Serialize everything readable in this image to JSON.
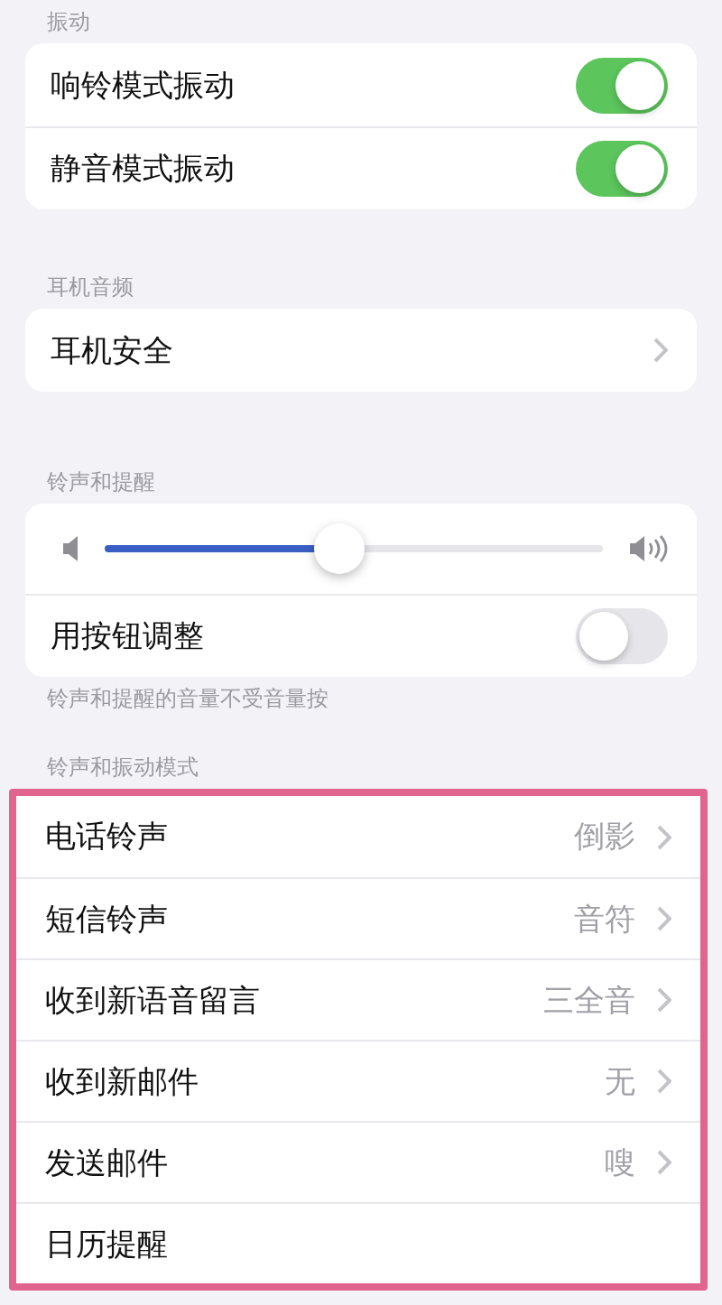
{
  "sections": [
    {
      "header": "振动",
      "highlighted": false,
      "rows": [
        {
          "kind": "toggle",
          "label": "响铃模式振动",
          "on": true
        },
        {
          "kind": "toggle",
          "label": "静音模式振动",
          "on": true
        }
      ]
    },
    {
      "header": "耳机音频",
      "highlighted": false,
      "rows": [
        {
          "kind": "link",
          "label": "耳机安全"
        }
      ]
    },
    {
      "header": "铃声和提醒",
      "highlighted": false,
      "rows": [
        {
          "kind": "slider",
          "level": 0.47
        },
        {
          "kind": "toggle",
          "label": "用按钮调整",
          "on": false
        }
      ],
      "footer": "铃声和提醒的音量不受音量按"
    },
    {
      "header": "铃声和振动模式",
      "highlighted": true,
      "rows": [
        {
          "kind": "link",
          "label": "电话铃声",
          "value": "倒影"
        },
        {
          "kind": "link",
          "label": "短信铃声",
          "value": "音符"
        },
        {
          "kind": "link",
          "label": "收到新语音留言",
          "value": "三全音"
        },
        {
          "kind": "link",
          "label": "收到新邮件",
          "value": "无"
        },
        {
          "kind": "link",
          "label": "发送邮件",
          "value": "嗖"
        },
        {
          "kind": "label",
          "label": "日历提醒"
        }
      ]
    }
  ]
}
